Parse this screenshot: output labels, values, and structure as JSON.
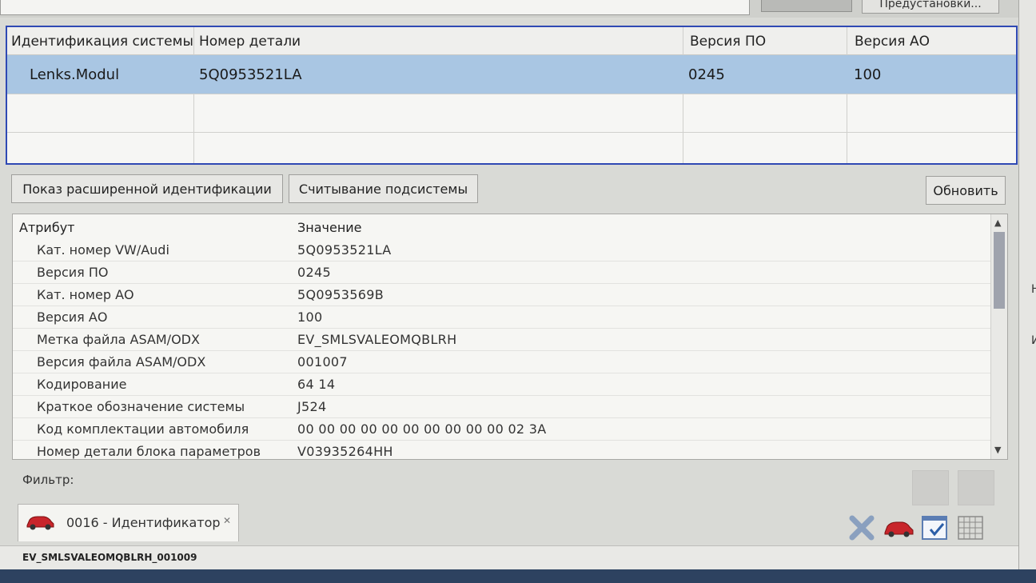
{
  "top": {
    "right_button_label": "Предустановки..."
  },
  "systems_table": {
    "headers": [
      "Идентификация системы",
      "Номер детали",
      "Версия ПО",
      "Версия АО"
    ],
    "rows": [
      [
        "Lenks.Modul",
        "5Q0953521LA",
        "0245",
        "100"
      ]
    ]
  },
  "buttons": {
    "extended_identification": "Показ расширенной идентификации",
    "read_subsystem": "Считывание подсистемы",
    "refresh": "Обновить"
  },
  "attributes": {
    "header_attribute": "Атрибут",
    "header_value": "Значение",
    "rows": [
      {
        "k": "Кат. номер VW/Audi",
        "v": "5Q0953521LA"
      },
      {
        "k": "Версия ПО",
        "v": "0245"
      },
      {
        "k": "Кат. номер АО",
        "v": "5Q0953569B"
      },
      {
        "k": "Версия АО",
        "v": "100"
      },
      {
        "k": "Метка файла ASAM/ODX",
        "v": "EV_SMLSVALEOMQBLRH"
      },
      {
        "k": "Версия файла ASAM/ODX",
        "v": "001007"
      },
      {
        "k": "Кодирование",
        "v": "64 14"
      },
      {
        "k": "Краткое обозначение системы",
        "v": "J524"
      },
      {
        "k": "Код комплектации автомобиля",
        "v": "00 00 00 00 00 00 00 00 00 00 02 3A"
      },
      {
        "k": "Номер детали блока параметров",
        "v": "V03935264HH"
      }
    ]
  },
  "filter": {
    "label": "Фильтр:"
  },
  "tab": {
    "label": "0016 - Идентификатор"
  },
  "status_bar": {
    "text": "EV_SMLSVALEOMQBLRH_001009"
  },
  "colors": {
    "selection": "#a9c6e3",
    "table_border": "#2f49b4",
    "car_icon": "#c8252b"
  },
  "icons": [
    "car-icon",
    "delete-x-icon",
    "car-icon",
    "checklist-icon",
    "grid-icon"
  ]
}
